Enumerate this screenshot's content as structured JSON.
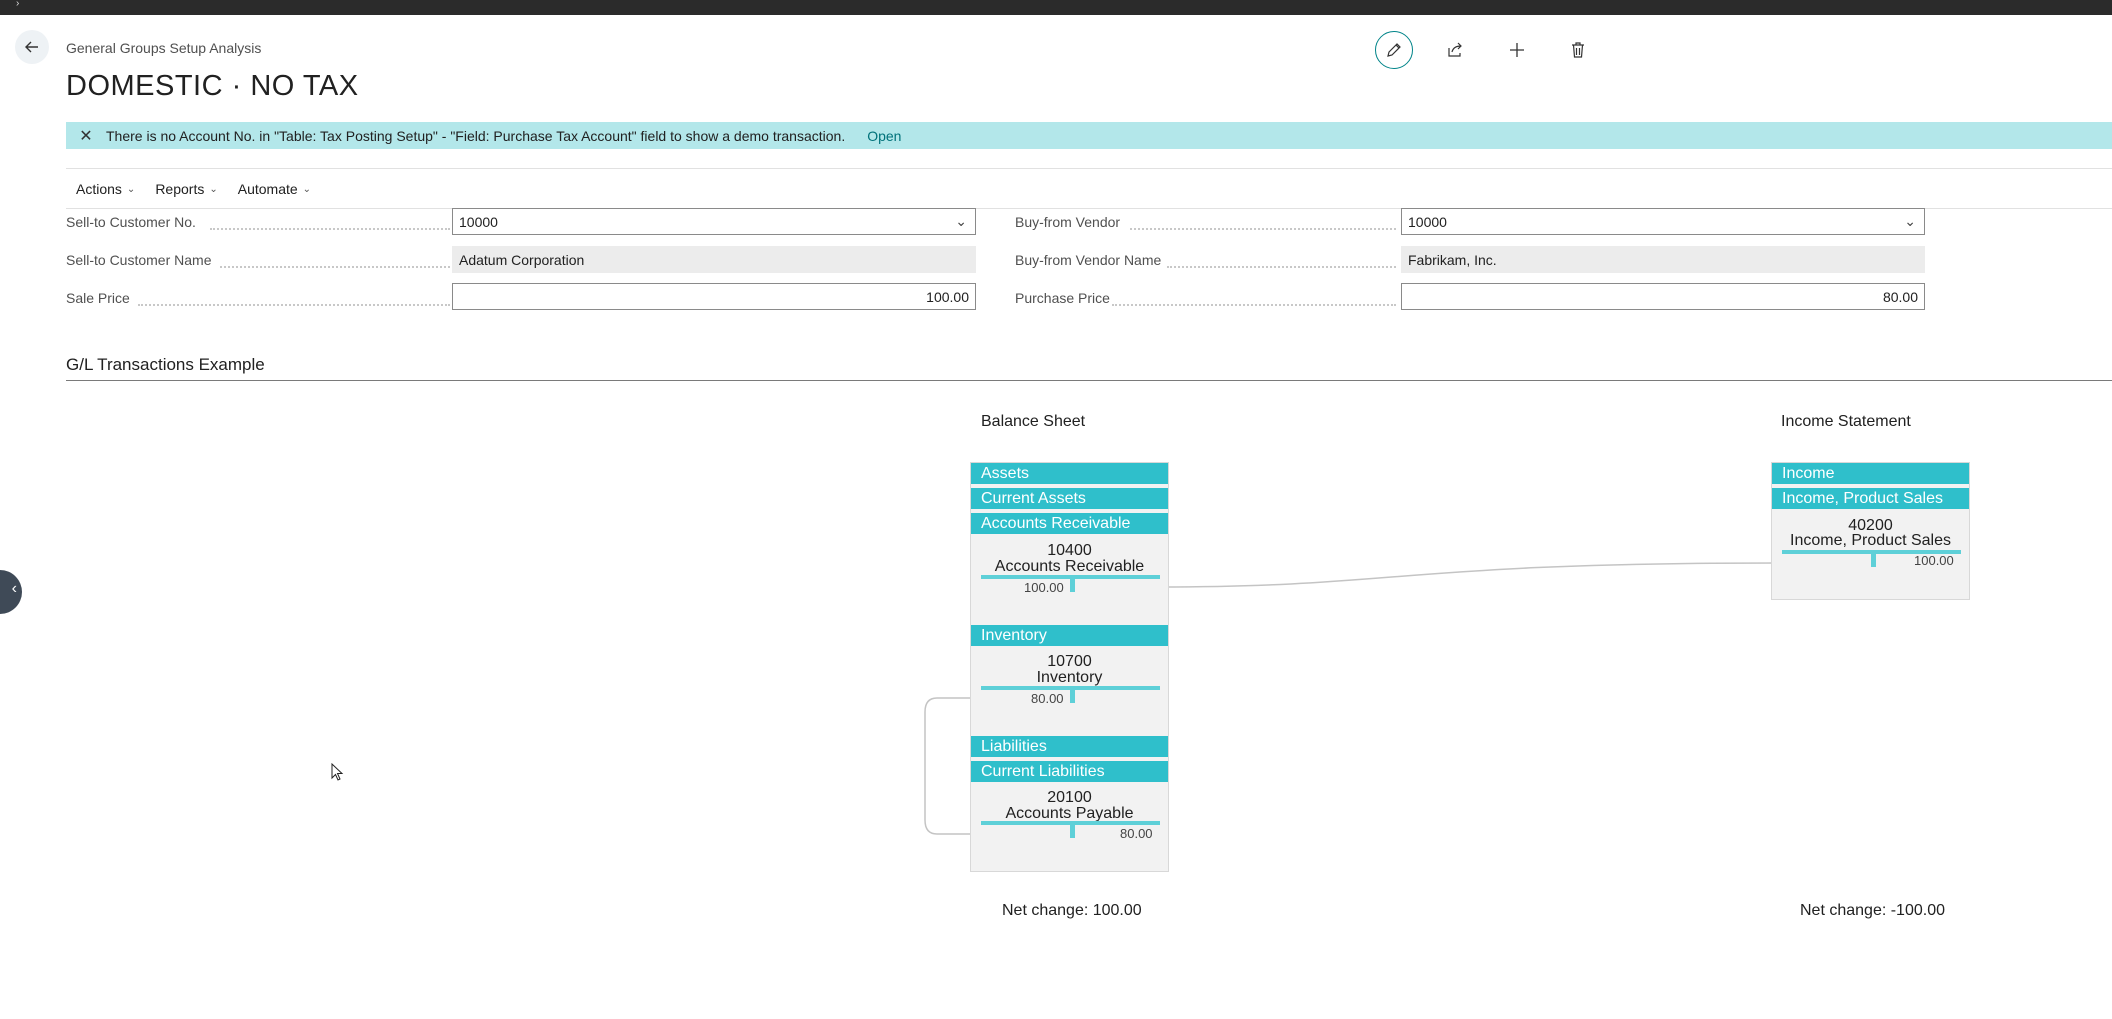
{
  "header": {
    "caption": "General Groups Setup Analysis",
    "title": "DOMESTIC · NO TAX"
  },
  "toolbar": {
    "edit_icon": "pencil-icon",
    "share_icon": "share-icon",
    "new_icon": "plus-icon",
    "delete_icon": "trash-icon"
  },
  "banner": {
    "message": "There is no Account No. in \"Table: Tax Posting Setup\" - \"Field: Purchase Tax Account\" field to show a demo transaction.",
    "link": "Open"
  },
  "actions": {
    "items": [
      {
        "label": "Actions"
      },
      {
        "label": "Reports"
      },
      {
        "label": "Automate"
      }
    ]
  },
  "form": {
    "sell_to_no": {
      "label": "Sell-to Customer No.",
      "value": "10000"
    },
    "sell_to_name": {
      "label": "Sell-to Customer Name",
      "value": "Adatum Corporation"
    },
    "sale_price": {
      "label": "Sale Price",
      "value": "100.00"
    },
    "buy_from_vendor": {
      "label": "Buy-from Vendor",
      "value": "10000"
    },
    "buy_from_name": {
      "label": "Buy-from Vendor Name",
      "value": "Fabrikam, Inc."
    },
    "purchase_price": {
      "label": "Purchase Price",
      "value": "80.00"
    }
  },
  "gl": {
    "section_title": "G/L Transactions Example",
    "balance_sheet": {
      "title": "Balance Sheet",
      "assets": "Assets",
      "current_assets": "Current Assets",
      "accounts_receivable_hdr": "Accounts Receivable",
      "ar_no": "10400",
      "ar_name": "Accounts Receivable",
      "ar_amount": "100.00",
      "inventory_hdr": "Inventory",
      "inv_no": "10700",
      "inv_name": "Inventory",
      "inv_amount": "80.00",
      "liabilities": "Liabilities",
      "current_liabilities": "Current Liabilities",
      "ap_no": "20100",
      "ap_name": "Accounts Payable",
      "ap_amount": "80.00",
      "net_change": "Net change: 100.00"
    },
    "income_statement": {
      "title": "Income Statement",
      "income": "Income",
      "income_product_sales_hdr": "Income, Product Sales",
      "acc_no": "40200",
      "acc_name": "Income, Product Sales",
      "amount": "100.00",
      "net_change": "Net change: -100.00"
    }
  },
  "colors": {
    "accent": "#2fbfcb",
    "banner": "#b3e7ea",
    "bar": "#5ed0d8"
  }
}
